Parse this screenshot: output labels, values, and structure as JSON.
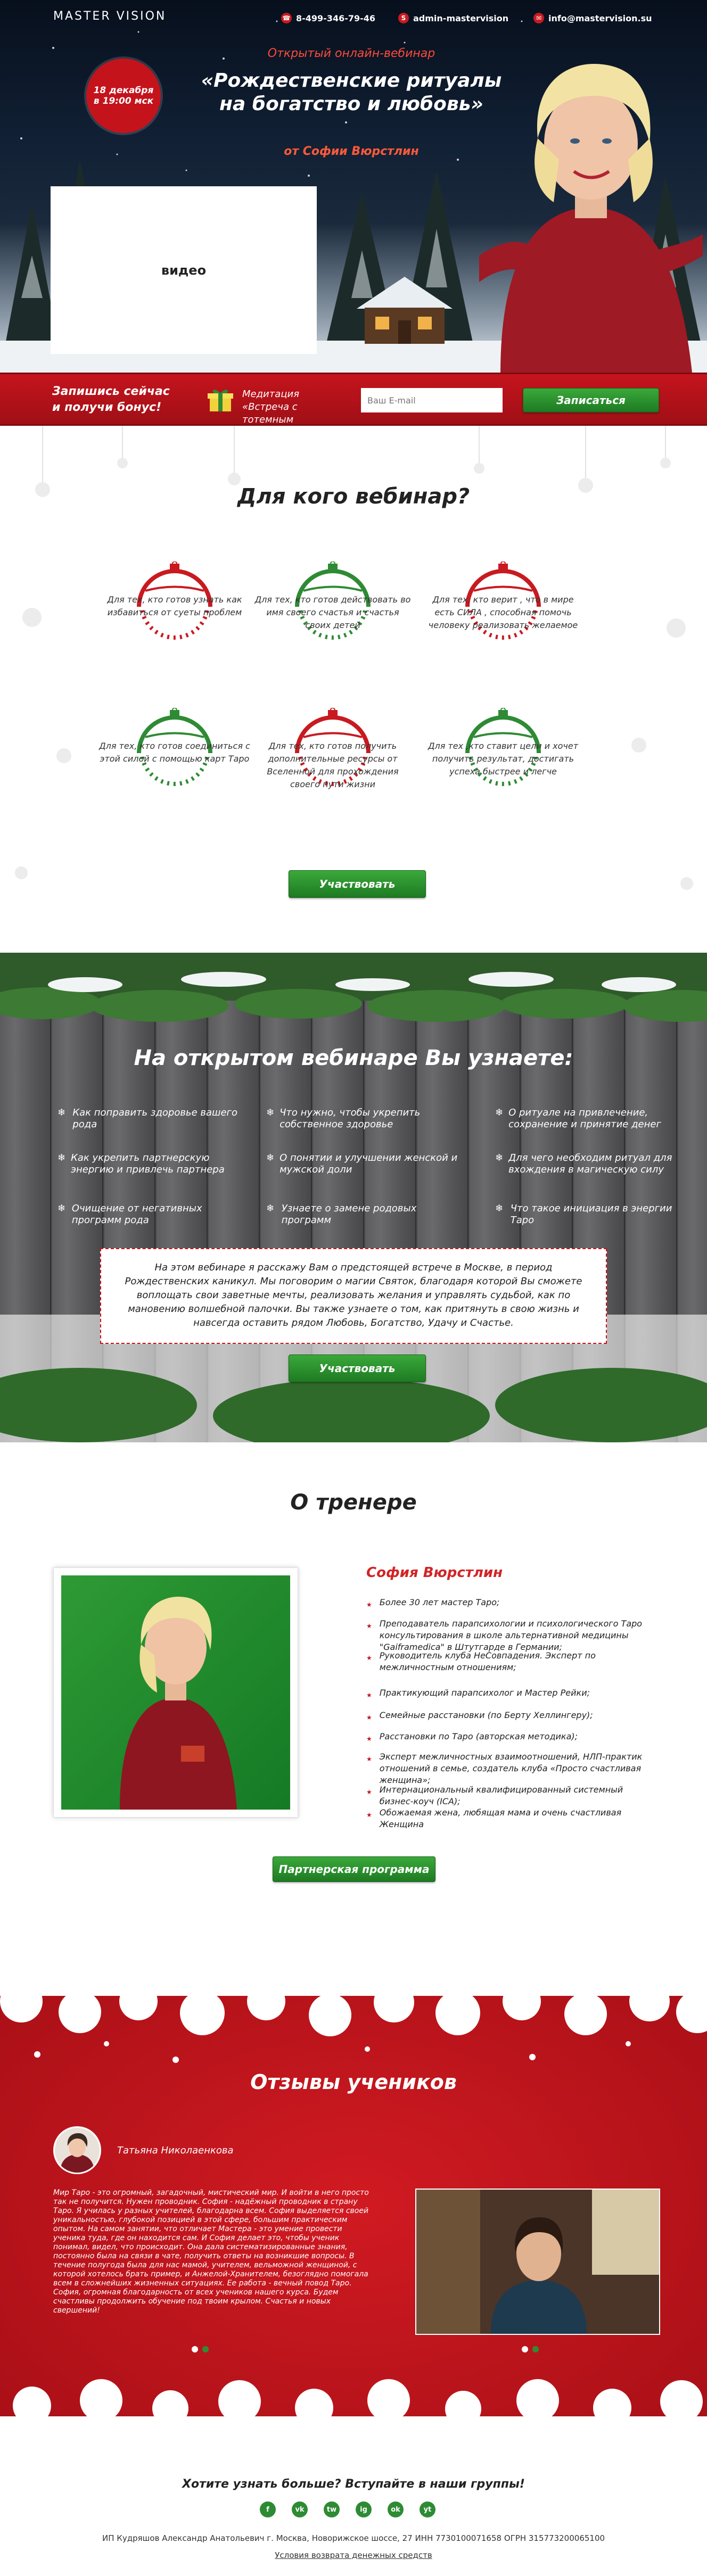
{
  "header": {
    "logo": "MASTER  VISION",
    "phone": "8-499-346-79-46",
    "skype": "admin-mastervision",
    "email": "info@mastervision.su",
    "date_line1": "18 декабря",
    "date_line2": "в 19:00 мск",
    "subtitle": "Открытый онлайн-вебинар",
    "title": "«Рождественские ритуалы на богатство и любовь»",
    "author": "от Софии Вюрстлин",
    "video_label": "видео"
  },
  "signup": {
    "call_line1": "Запишись сейчас",
    "call_line2": "и получи бонус!",
    "meditation": "Медитация «Встреча с тотемным животным»",
    "email_placeholder": "Ваш E-mail",
    "button": "Записаться"
  },
  "audience": {
    "title": "Для кого вебинар?",
    "items": [
      {
        "text": "Для тех, кто готов узнать как избавиться от суеты проблем",
        "color": "#c81a20"
      },
      {
        "text": "Для тех, кто готов действовать во имя своего счастья и счастья своих детей",
        "color": "#2e8b34"
      },
      {
        "text": "Для тех, кто верит , что в мире есть СИЛА , способная помочь человеку реализовать желаемое",
        "color": "#c81a20"
      },
      {
        "text": "Для тех, кто готов соединиться с этой силой с помощью карт Таро",
        "color": "#2e8b34"
      },
      {
        "text": "Для тех, кто готов получить дополнительные ресурсы от Вселенной для прохождения своего пути жизни",
        "color": "#c81a20"
      },
      {
        "text": "Для тех ,кто ставит цели и хочет получить результат, достигать успеха быстрее и легче",
        "color": "#2e8b34"
      }
    ],
    "button": "Участвовать"
  },
  "learn": {
    "title": "На открытом вебинаре Вы узнаете:",
    "items": [
      "Как поправить здоровье вашего рода",
      "Что нужно, чтобы укрепить собственное здоровье",
      "О ритуале на привлечение, сохранение и принятие денег",
      "Как укрепить партнерскую энергию и привлечь партнера",
      "О понятии и улучшении женской и мужской доли",
      "Для чего необходим ритуал для вхождения в магическую силу",
      "Очищение от негативных программ рода",
      "Узнаете о замене родовых программ",
      "Что такое инициация в энергии Таро"
    ],
    "info": "На этом вебинаре я расскажу Вам о предстоящей встрече в Москве, в период Рождественских каникул. Мы поговорим о магии Святок, благодаря которой Вы сможете воплощать свои заветные мечты, реализовать желания и управлять судьбой, как по мановению волшебной палочки. Вы также узнаете о том, как притянуть в свою жизнь и навсегда оставить рядом Любовь, Богатство, Удачу и Счастье.",
    "button": "Участвовать"
  },
  "trainer": {
    "title": "О тренере",
    "name": "София Вюрстлин",
    "bullets": [
      "Более 30 лет мастер Таро;",
      "Преподаватель парапсихологии и психологического Таро консультирования в школе альтернативной медицины \"Gaiframedica\" в Штутгарде в Германии;",
      "Руководитель клуба НеСовпадения. Эксперт по межличностным отношениям;",
      "Практикующий парапсихолог и Мастер Рейки;",
      "Семейные расстановки (по Берту Хеллингеру);",
      "Расстановки по Таро (авторская методика);",
      "Эксперт межличностных взаимоотношений, НЛП-практик отношений в семье, создатель клуба «Просто счастливая женщина»;",
      "Интернациональный квалифицированный системный бизнес-коуч (ICA);",
      "Обожаемая жена, любящая мама и очень счастливая Женщина"
    ],
    "button": "Партнерская программа"
  },
  "reviews": {
    "title": "Отзывы учеников",
    "name": "Татьяна Николаенкова",
    "text": "Мир Таро - это огромный, загадочный, мистический мир. И войти в него просто так не получится. Нужен проводник. София - надёжный проводник в страну Таро. Я училась у разных учителей, благодарна всем. София выделяется своей уникальностью, глубокой позицией в этой сфере, большим практическим опытом. На самом занятии, что отличает Мастера - это умение провести ученика туда, где он находится сам. И София делает это, чтобы ученик понимал, видел, что происходит. Она дала систематизированные знания, постоянно была на связи в чате, получить ответы на возникшие вопросы. В течение полугода была для нас мамой, учителем, вельможной женщиной, с которой хотелось брать пример, и Анжелой-Хранителем, безоглядно помогала всем в сложнейших жизненных ситуациях. Ее работа - вечный повод Таро. София, огромная благодарность от всех учеников нашего курса. Будем счастливы продолжить обучение под твоим крылом. Счастья и новых свершений!"
  },
  "footer": {
    "join": "Хотите узнать больше? Вступайте в наши группы!",
    "socials": [
      "f",
      "vk",
      "tw",
      "ig",
      "ok",
      "yt"
    ],
    "legal": "ИП Кудряшов Александр Анатольевич г. Москва, Новорижское шоссе, 27 ИНН 7730100071658 ОГРН 315773200065100",
    "refund": "Условия возврата денежных средств"
  }
}
